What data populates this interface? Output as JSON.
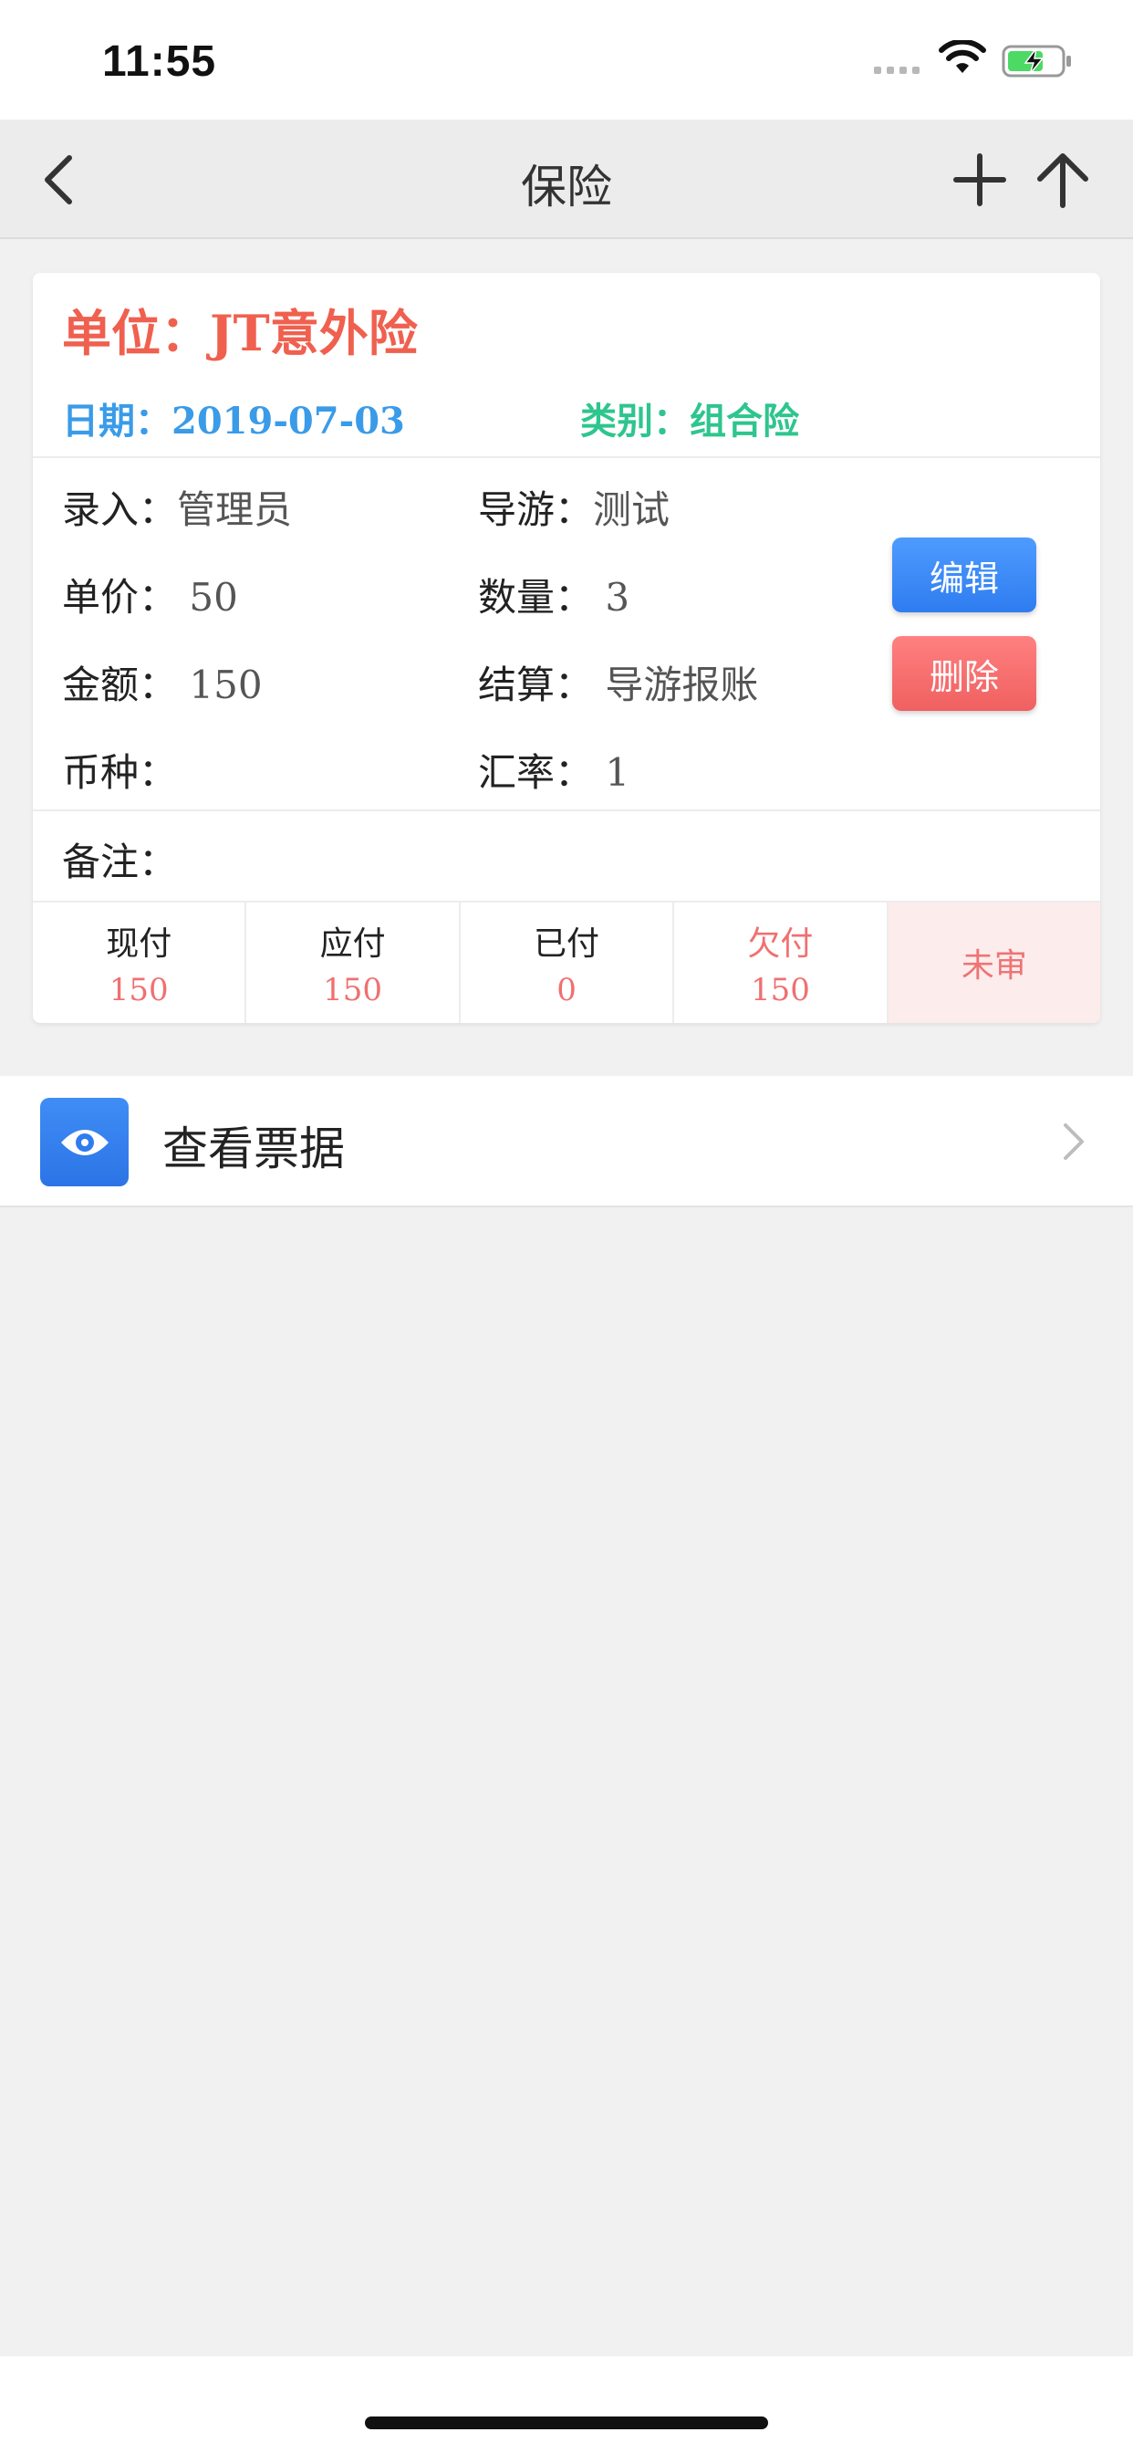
{
  "status_bar": {
    "time": "11:55"
  },
  "nav": {
    "title": "保险",
    "back_icon": "chevron-left-icon",
    "add_icon": "plus-icon",
    "up_icon": "arrow-up-icon"
  },
  "card": {
    "unit": "单位：JT意外险",
    "date": "日期：2019-07-03",
    "category": "类别：组合险",
    "fields": {
      "entered_by": {
        "label": "录入：",
        "value": "管理员"
      },
      "guide": {
        "label": "导游：",
        "value": "测试"
      },
      "unit_price": {
        "label": "单价：",
        "value": "50"
      },
      "quantity": {
        "label": "数量：",
        "value": "3"
      },
      "amount": {
        "label": "金额：",
        "value": "150"
      },
      "settlement": {
        "label": "结算：",
        "value": "导游报账"
      },
      "currency": {
        "label": "币种：",
        "value": ""
      },
      "exchange_rate": {
        "label": "汇率：",
        "value": "1"
      },
      "remark": {
        "label": "备注：",
        "value": ""
      }
    },
    "buttons": {
      "edit": "编辑",
      "delete": "删除"
    },
    "summary": [
      {
        "label": "现付",
        "value": "150"
      },
      {
        "label": "应付",
        "value": "150"
      },
      {
        "label": "已付",
        "value": "0"
      },
      {
        "label": "欠付",
        "value": "150"
      }
    ],
    "status": "未审"
  },
  "receipts": {
    "label": "查看票据",
    "icon": "eye-icon"
  },
  "colors": {
    "unit_red": "#f0604f",
    "date_blue": "#3a9be8",
    "category_green": "#2ec58e",
    "edit_blue": "#2f7cf0",
    "delete_red": "#f06060"
  }
}
